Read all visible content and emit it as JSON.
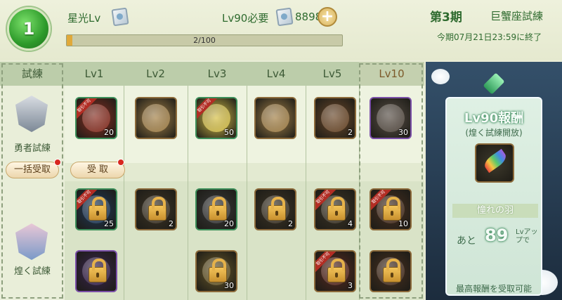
{
  "header": {
    "level": "1",
    "star_label": "星光Lv",
    "req_label": "Lv90必要",
    "star_count": "8898",
    "plus": "+",
    "progress_text": "2/100",
    "progress_fraction": 0.02,
    "season": "第3期",
    "trial_name": "巨蟹座試練",
    "deadline": "今期07月21日23:59に終了"
  },
  "grid": {
    "trial_header": "試練",
    "columns": [
      "Lv1",
      "Lv2",
      "Lv3",
      "Lv4",
      "Lv5",
      "Lv10"
    ],
    "hero_trial_label": "勇者試練",
    "brilliant_trial_label": "煌く試練",
    "claim_all": "一括受取",
    "claim": "受 取",
    "ribbon_text": "取引不可",
    "hero_items": [
      {
        "qty": "20",
        "color": "#8c2f22",
        "frame": "green",
        "ribbon": true
      },
      {
        "qty": "",
        "color": "#a7844a",
        "frame": "brown",
        "ribbon": false
      },
      {
        "qty": "50",
        "color": "#d8c24a",
        "frame": "green",
        "ribbon": true
      },
      {
        "qty": "",
        "color": "#a7844a",
        "frame": "brown",
        "ribbon": false
      },
      {
        "qty": "2",
        "color": "#6e4a2a",
        "frame": "brown",
        "ribbon": false
      },
      {
        "qty": "30",
        "color": "#5a5047",
        "frame": "purple",
        "ribbon": false
      }
    ],
    "brilliant_row1": [
      {
        "qty": "25",
        "color": "#1f3a5a",
        "frame": "green",
        "ribbon": true
      },
      {
        "qty": "2",
        "color": "#3e3526",
        "frame": "brown",
        "ribbon": false
      },
      {
        "qty": "20",
        "color": "#3a3a3a",
        "frame": "green",
        "ribbon": false
      },
      {
        "qty": "2",
        "color": "#3e3526",
        "frame": "brown",
        "ribbon": false
      },
      {
        "qty": "4",
        "color": "#3e3526",
        "frame": "brown",
        "ribbon": true
      },
      {
        "qty": "10",
        "color": "#4a3020",
        "frame": "brown",
        "ribbon": true
      }
    ],
    "brilliant_row2": [
      {
        "qty": "",
        "color": "#3a2450",
        "frame": "purple",
        "ribbon": false
      },
      {
        "qty": "30",
        "color": "#6b5a2a",
        "frame": "brown",
        "ribbon": false
      },
      {
        "qty": "3",
        "color": "#5a2a20",
        "frame": "brown",
        "ribbon": true
      },
      {
        "qty": "",
        "color": "#4a3020",
        "frame": "brown",
        "ribbon": false
      }
    ]
  },
  "reward": {
    "title": "Lv90報酬",
    "subtitle": "(煌く試練開放)",
    "item_name": "憧れの羽",
    "remain_label": "あと",
    "remain_value": "89",
    "remain_unit": "Lvアップで",
    "note": "最高報酬を受取可能"
  },
  "colors": {
    "accent_green": "#2f6b2f",
    "progress_fill": "#e0a93a",
    "panel_dark": "#1c2c3d",
    "notification_red": "#d8261e"
  }
}
